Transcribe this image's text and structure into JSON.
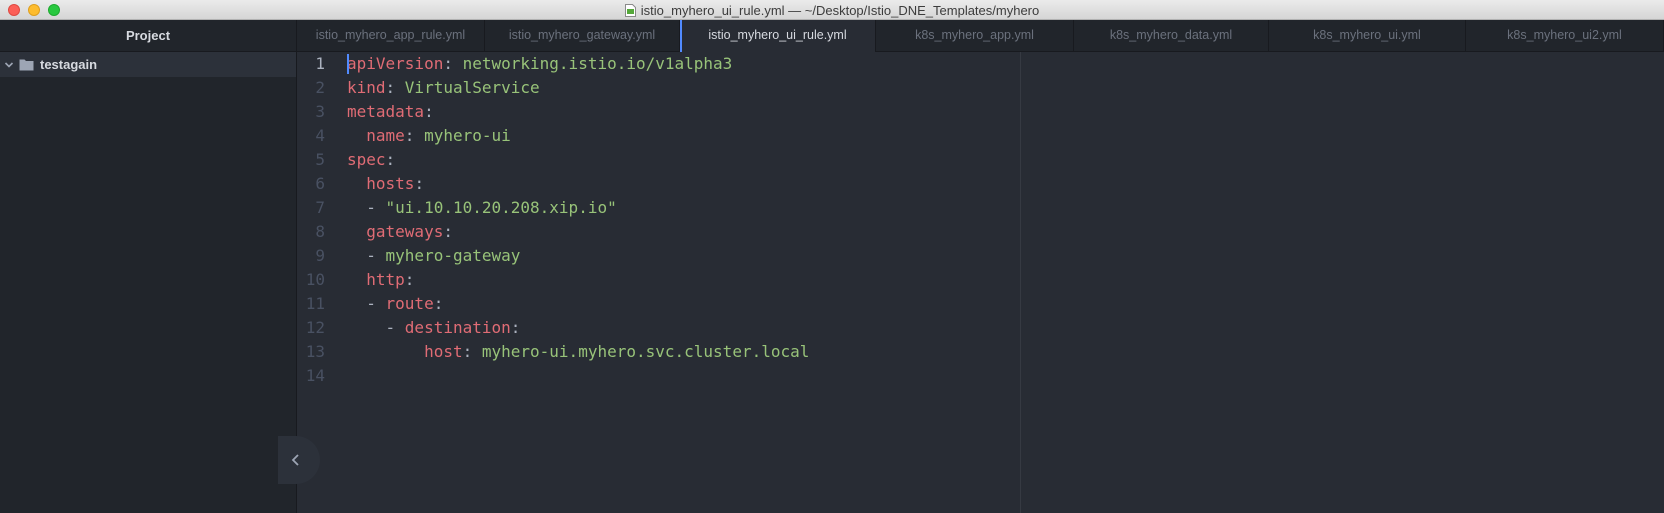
{
  "window": {
    "title": "istio_myhero_ui_rule.yml — ~/Desktop/Istio_DNE_Templates/myhero",
    "file_icon": "yaml-file-icon"
  },
  "tree": {
    "header": "Project",
    "root_folder": "testagain"
  },
  "tabs": [
    {
      "label": "istio_myhero_app_rule.yml",
      "active": false
    },
    {
      "label": "istio_myhero_gateway.yml",
      "active": false
    },
    {
      "label": "istio_myhero_ui_rule.yml",
      "active": true
    },
    {
      "label": "k8s_myhero_app.yml",
      "active": false
    },
    {
      "label": "k8s_myhero_data.yml",
      "active": false
    },
    {
      "label": "k8s_myhero_ui.yml",
      "active": false
    },
    {
      "label": "k8s_myhero_ui2.yml",
      "active": false
    }
  ],
  "editor": {
    "line_numbers": [
      "1",
      "2",
      "3",
      "4",
      "5",
      "6",
      "7",
      "8",
      "9",
      "10",
      "11",
      "12",
      "13",
      "14"
    ],
    "current_line": 1,
    "lines": [
      [
        {
          "t": "apiVersion",
          "c": "k"
        },
        {
          "t": ": ",
          "c": "p"
        },
        {
          "t": "networking.istio.io/v1alpha3",
          "c": "v"
        }
      ],
      [
        {
          "t": "kind",
          "c": "k"
        },
        {
          "t": ": ",
          "c": "p"
        },
        {
          "t": "VirtualService",
          "c": "v"
        }
      ],
      [
        {
          "t": "metadata",
          "c": "k"
        },
        {
          "t": ":",
          "c": "p"
        }
      ],
      [
        {
          "t": "  ",
          "c": "p"
        },
        {
          "t": "name",
          "c": "k"
        },
        {
          "t": ": ",
          "c": "p"
        },
        {
          "t": "myhero-ui",
          "c": "v"
        }
      ],
      [
        {
          "t": "spec",
          "c": "k"
        },
        {
          "t": ":",
          "c": "p"
        }
      ],
      [
        {
          "t": "  ",
          "c": "p"
        },
        {
          "t": "hosts",
          "c": "k"
        },
        {
          "t": ":",
          "c": "p"
        }
      ],
      [
        {
          "t": "  - ",
          "c": "p"
        },
        {
          "t": "\"ui.10.10.20.208.xip.io\"",
          "c": "v"
        }
      ],
      [
        {
          "t": "  ",
          "c": "p"
        },
        {
          "t": "gateways",
          "c": "k"
        },
        {
          "t": ":",
          "c": "p"
        }
      ],
      [
        {
          "t": "  - ",
          "c": "p"
        },
        {
          "t": "myhero-gateway",
          "c": "v"
        }
      ],
      [
        {
          "t": "  ",
          "c": "p"
        },
        {
          "t": "http",
          "c": "k"
        },
        {
          "t": ":",
          "c": "p"
        }
      ],
      [
        {
          "t": "  - ",
          "c": "p"
        },
        {
          "t": "route",
          "c": "k"
        },
        {
          "t": ":",
          "c": "p"
        }
      ],
      [
        {
          "t": "    - ",
          "c": "p"
        },
        {
          "t": "destination",
          "c": "k"
        },
        {
          "t": ":",
          "c": "p"
        }
      ],
      [
        {
          "t": "        ",
          "c": "p"
        },
        {
          "t": "host",
          "c": "k"
        },
        {
          "t": ": ",
          "c": "p"
        },
        {
          "t": "myhero-ui.myhero.svc.cluster.local",
          "c": "v"
        }
      ],
      []
    ]
  },
  "colors": {
    "key": "#e06c75",
    "value": "#98c379",
    "accent": "#528bff"
  }
}
